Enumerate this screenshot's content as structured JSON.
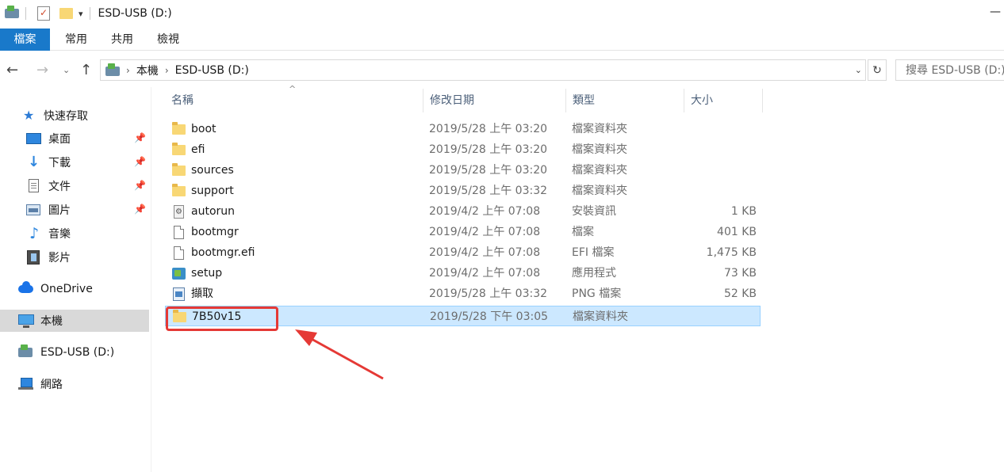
{
  "window": {
    "title": "ESD-USB (D:)",
    "minimize_glyph": "—"
  },
  "ribbon": {
    "tabs": [
      {
        "label": "檔案",
        "active": true
      },
      {
        "label": "常用",
        "active": false
      },
      {
        "label": "共用",
        "active": false
      },
      {
        "label": "檢視",
        "active": false
      }
    ]
  },
  "navigation": {
    "breadcrumbs": [
      "本機",
      "ESD-USB (D:)"
    ],
    "search_placeholder": "搜尋 ESD-USB (D:)"
  },
  "sidebar": {
    "quick_access_label": "快速存取",
    "quick_items": [
      {
        "label": "桌面",
        "icon": "desktop-icon",
        "pinned": true
      },
      {
        "label": "下載",
        "icon": "download-icon",
        "pinned": true
      },
      {
        "label": "文件",
        "icon": "documents-icon",
        "pinned": true
      },
      {
        "label": "圖片",
        "icon": "pictures-icon",
        "pinned": true
      },
      {
        "label": "音樂",
        "icon": "music-icon",
        "pinned": false
      },
      {
        "label": "影片",
        "icon": "videos-icon",
        "pinned": false
      }
    ],
    "onedrive_label": "OneDrive",
    "this_pc_label": "本機",
    "drive_label": "ESD-USB (D:)",
    "network_label": "網路"
  },
  "columns": {
    "name": "名稱",
    "date": "修改日期",
    "type": "類型",
    "size": "大小"
  },
  "files": [
    {
      "name": "boot",
      "date": "2019/5/28 上午 03:20",
      "type": "檔案資料夾",
      "size": "",
      "icon": "folder-icon"
    },
    {
      "name": "efi",
      "date": "2019/5/28 上午 03:20",
      "type": "檔案資料夾",
      "size": "",
      "icon": "folder-icon"
    },
    {
      "name": "sources",
      "date": "2019/5/28 上午 03:20",
      "type": "檔案資料夾",
      "size": "",
      "icon": "folder-icon"
    },
    {
      "name": "support",
      "date": "2019/5/28 上午 03:32",
      "type": "檔案資料夾",
      "size": "",
      "icon": "folder-icon"
    },
    {
      "name": "autorun",
      "date": "2019/4/2 上午 07:08",
      "type": "安裝資訊",
      "size": "1 KB",
      "icon": "setup-info-icon"
    },
    {
      "name": "bootmgr",
      "date": "2019/4/2 上午 07:08",
      "type": "檔案",
      "size": "401 KB",
      "icon": "file-icon"
    },
    {
      "name": "bootmgr.efi",
      "date": "2019/4/2 上午 07:08",
      "type": "EFI 檔案",
      "size": "1,475 KB",
      "icon": "file-icon"
    },
    {
      "name": "setup",
      "date": "2019/4/2 上午 07:08",
      "type": "應用程式",
      "size": "73 KB",
      "icon": "application-icon"
    },
    {
      "name": "擷取",
      "date": "2019/5/28 上午 03:32",
      "type": "PNG 檔案",
      "size": "52 KB",
      "icon": "png-icon"
    },
    {
      "name": "7B50v15",
      "date": "2019/5/28 下午 03:05",
      "type": "檔案資料夾",
      "size": "",
      "icon": "folder-icon",
      "selected": true
    }
  ],
  "colors": {
    "ribbon_active": "#1979ca",
    "selection_bg": "#cce8ff",
    "selection_border": "#99d1ff",
    "annotation": "#e53935",
    "folder": "#f8d775"
  }
}
